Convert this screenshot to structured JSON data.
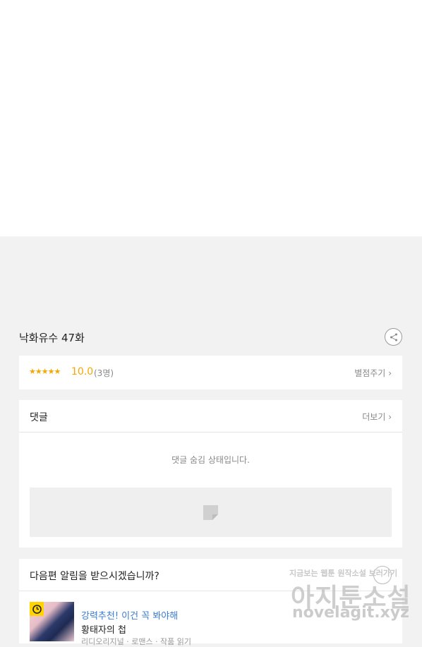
{
  "episode": {
    "title": "낙화유수 47화"
  },
  "rating": {
    "stars": "★★★★★",
    "score": "10.0",
    "count": "(3명)",
    "rate_button": "별점주기"
  },
  "comments": {
    "title": "댓글",
    "more_button": "더보기",
    "hidden_message": "댓글 숨김 상태입니다."
  },
  "notify": {
    "question": "다음편 알림을 받으시겠습니까?"
  },
  "recommendation": {
    "label": "강력추천! 이건 꼭 봐야해",
    "title": "황태자의 첩",
    "subtitle": "리디오리지널 · 로맨스 · 작품 읽기"
  },
  "watermark": {
    "tagline": "지금보는 웹툰 원작소설 보러가기",
    "site_name": "아지툰소설",
    "url": "novelagit.xyz"
  },
  "colors": {
    "accent_star": "#f6a700",
    "link_blue": "#3a7bd5",
    "badge_yellow": "#ffd400"
  },
  "icons": {
    "share": "share-icon",
    "chevron": "chevron-right-icon",
    "clock": "clock-icon",
    "document": "document-icon"
  }
}
